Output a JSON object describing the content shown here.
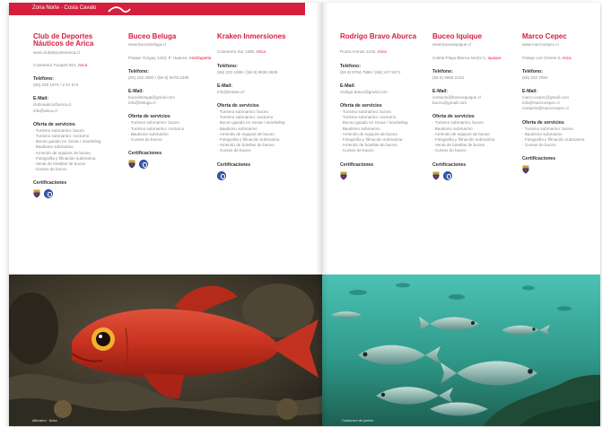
{
  "header": {
    "title": "Zona Norte · Costa Cavalo"
  },
  "colors": {
    "brand": "#d41f3e",
    "text": "#8a8a8a",
    "water_left": "#3d3a30",
    "water_right": "#3fa396"
  },
  "entries": [
    {
      "name": "Club de Deportes Náuticos de Arica",
      "web": "www.clubdeportesarica.cl",
      "address": "Costanera Tucapel 821,",
      "city": "Arica",
      "phone_label": "Teléfono:",
      "phone": "(58) 225 1574 / 2 51 574",
      "email_label": "E-Mail:",
      "email": [
        "clubnautico@arica.cl",
        "info@arica.cl"
      ],
      "services_label": "Oferta de servicios",
      "services": [
        "Turismo submarino: buceo",
        "Turismo submarino: nocturno",
        "Buceo guiado en zonas / snorkeling",
        "Bautismo submarino",
        "Arriendo de equipos de buceo",
        "Fotografía y filmación submarina",
        "Venta de botellas de buceo",
        "Cursos de buceo"
      ],
      "cert_label": "Certificaciones",
      "certs": [
        "shield",
        "round"
      ]
    },
    {
      "name": "Buceo Beluga",
      "web": "www.buceobeluga.cl",
      "address": "Pasaje Yungay 1423, P. Huanca,",
      "city": "Antofagasta",
      "phone_label": "Teléfono:",
      "phone": "(55) 222 2652 / (56 9) 9078 2295",
      "email_label": "E-Mail:",
      "email": [
        "buceobeluga@gmail.com",
        "info@beluga.cl"
      ],
      "services_label": "Oferta de servicios",
      "services": [
        "Turismo submarino: buceo",
        "Turismo submarino: nocturno",
        "Bautismo submarino",
        "Cursos de buceo"
      ],
      "cert_label": "Certificaciones",
      "certs": [
        "shield",
        "round"
      ]
    },
    {
      "name": "Kraken Inmersiones",
      "web": "",
      "address": "Costanera Sur 1280,",
      "city": "Arica",
      "phone_label": "Teléfono:",
      "phone": "(58) 223 1696 / (56 9) 9638 2829",
      "email_label": "E-Mail:",
      "email": [
        "info@kraken.cl"
      ],
      "services_label": "Oferta de servicios",
      "services": [
        "Turismo submarino: buceo",
        "Turismo submarino: nocturno",
        "Buceo guiado en zonas / snorkeling",
        "Bautismo submarino",
        "Arriendo de equipos de buceo",
        "Fotografía y filmación submarina",
        "Arriendo de botellas de buceo",
        "Cursos de buceo"
      ],
      "cert_label": "Certificaciones",
      "certs": [
        "round"
      ]
    },
    {
      "name": "Rodrigo Bravo Aburca",
      "web": "",
      "address": "Punta Arenas 1216,",
      "city": "Arica",
      "phone_label": "Teléfono:",
      "phone": "(56 9) 8794 7566 / (58) 247 9471",
      "email_label": "E-Mail:",
      "email": [
        "rodrigo.bravo@gmail.com"
      ],
      "services_label": "Oferta de servicios",
      "services": [
        "Turismo submarino: buceo",
        "Turismo submarino: nocturno",
        "Buceo guiado en zonas / snorkeling",
        "Bautismo submarino",
        "Arriendo de equipos de buceo",
        "Fotografía y filmación submarina",
        "Arriendo de botellas de buceo",
        "Cursos de buceo"
      ],
      "cert_label": "Certificaciones",
      "certs": [
        "shield"
      ]
    },
    {
      "name": "Buceo Iquique",
      "web": "www.buceoiquique.cl",
      "address": "Caleta Playa Blanca sector 1,",
      "city": "Iquique",
      "phone_label": "Teléfono:",
      "phone": "(56 9) 9868 2413",
      "email_label": "E-Mail:",
      "email": [
        "contacto@buceoiquique.cl",
        "buceo@gmail.com"
      ],
      "services_label": "Oferta de servicios",
      "services": [
        "Turismo submarino: buceo",
        "Bautismo submarino",
        "Arriendo de equipos de buceo",
        "Fotografía y filmación submarina",
        "Venta de botellas de buceo",
        "Cursos de buceo"
      ],
      "cert_label": "Certificaciones",
      "certs": [
        "shield",
        "round"
      ]
    },
    {
      "name": "Marco Cepec",
      "web": "www.marcocepec.cl",
      "address": "Pasaje Los Cisnes 3,",
      "city": "Arica",
      "phone_label": "Teléfono:",
      "phone": "(58) 222 7854",
      "email_label": "E-Mail:",
      "email": [
        "marco.cepec@gmail.com",
        "info@marcocepec.cl",
        "contacto@marcocepec.cl"
      ],
      "services_label": "Oferta de servicios",
      "services": [
        "Turismo submarino: buceo",
        "Bautismo submarino",
        "Fotografía y filmación submarina",
        "Cursos de buceo"
      ],
      "cert_label": "Certificaciones",
      "certs": [
        "shield"
      ]
    }
  ],
  "photos": {
    "left_caption": "Alfonsino · Arica",
    "right_caption": "Cardumen de jureles"
  }
}
